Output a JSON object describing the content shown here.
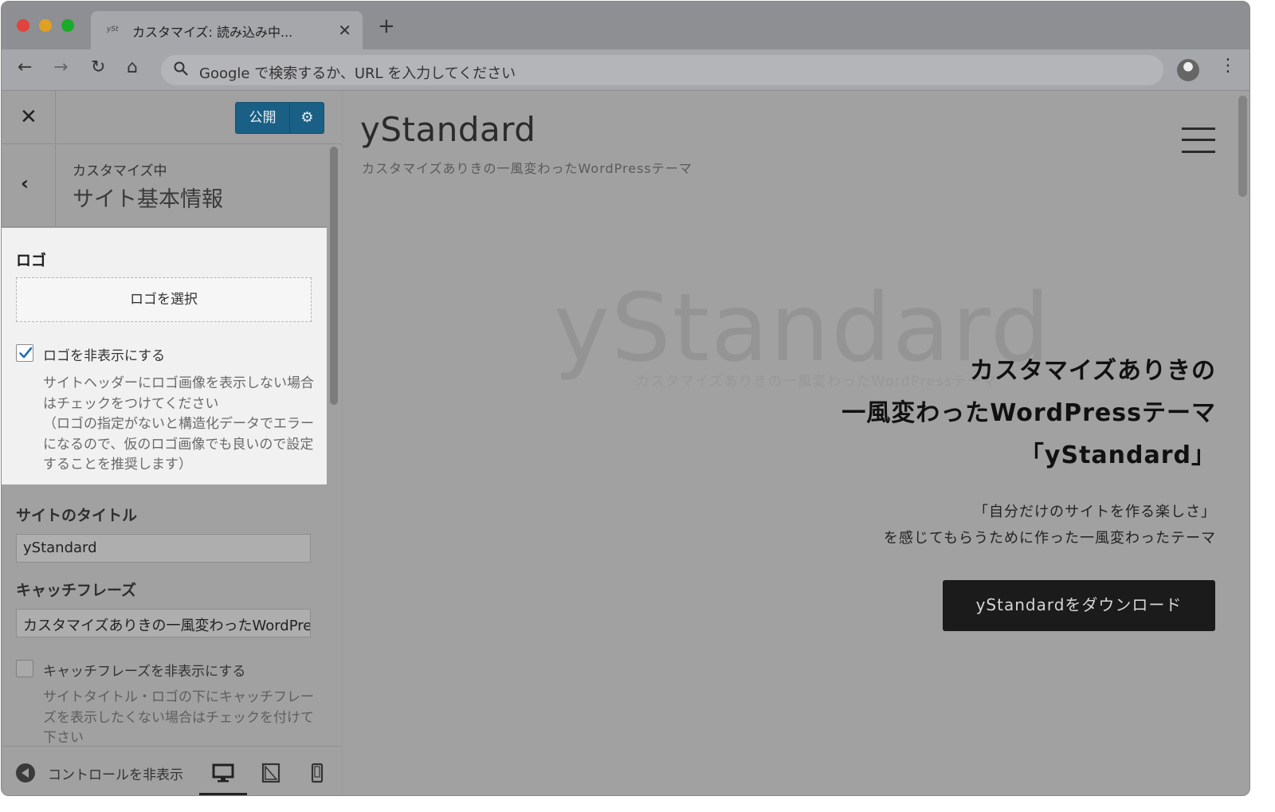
{
  "browser": {
    "tab": {
      "favicon_text": "ySt",
      "title": "カスタマイズ: 読み込み中..."
    },
    "omnibox_placeholder": "Google で検索するか、URL を入力してください"
  },
  "customizer": {
    "publish_label": "公開",
    "section": {
      "breadcrumb": "カスタマイズ中",
      "title": "サイト基本情報"
    },
    "logo": {
      "heading": "ロゴ",
      "select_label": "ロゴを選択",
      "hide_checked": true,
      "hide_label": "ロゴを非表示にする",
      "hide_desc_1": "サイトヘッダーにロゴ画像を表示しない場合はチェックをつけてください",
      "hide_desc_2": "（ロゴの指定がないと構造化データでエラーになるので、仮のロゴ画像でも良いので設定することを推奨します）"
    },
    "site_title": {
      "label": "サイトのタイトル",
      "value": "yStandard"
    },
    "catchphrase": {
      "label": "キャッチフレーズ",
      "value": "カスタマイズありきの一風変わったWordPressテーマ"
    },
    "catch_hide": {
      "checked": false,
      "label": "キャッチフレーズを非表示にする",
      "desc": "サイトタイトル・ロゴの下にキャッチフレーズを表示したくない場合はチェックを付けて下さい"
    },
    "footer": {
      "collapse_label": "コントロールを非表示"
    }
  },
  "preview": {
    "site_title": "yStandard",
    "tagline": "カスタマイズありきの一風変わったWordPressテーマ",
    "watermark": "yStandard",
    "watermark_sub": "カスタマイズありきの一風変わったWordPressテーマ",
    "hero_lines": [
      "カスタマイズありきの",
      "一風変わったWordPressテーマ",
      "「yStandard」"
    ],
    "lead_lines": [
      "「自分だけのサイトを作る楽しさ」",
      "を感じてもらうために作った一風変わったテーマ"
    ],
    "download_label": "yStandardをダウンロード"
  },
  "colors": {
    "publish_bg": "#1a5f85",
    "check_blue": "#2271b1",
    "download_bg": "#1b1b1b"
  }
}
